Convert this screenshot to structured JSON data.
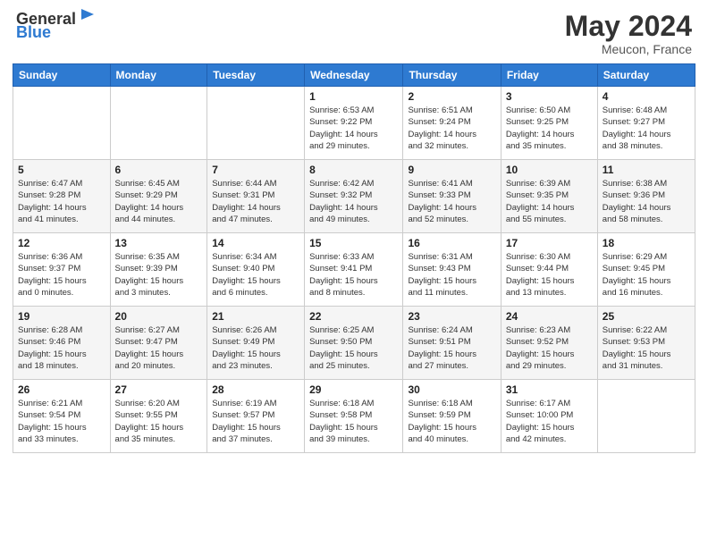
{
  "header": {
    "logo_text_general": "General",
    "logo_text_blue": "Blue",
    "title": "May 2024",
    "subtitle": "Meucon, France"
  },
  "days_of_week": [
    "Sunday",
    "Monday",
    "Tuesday",
    "Wednesday",
    "Thursday",
    "Friday",
    "Saturday"
  ],
  "weeks": [
    [
      {
        "day": "",
        "info": ""
      },
      {
        "day": "",
        "info": ""
      },
      {
        "day": "",
        "info": ""
      },
      {
        "day": "1",
        "info": "Sunrise: 6:53 AM\nSunset: 9:22 PM\nDaylight: 14 hours\nand 29 minutes."
      },
      {
        "day": "2",
        "info": "Sunrise: 6:51 AM\nSunset: 9:24 PM\nDaylight: 14 hours\nand 32 minutes."
      },
      {
        "day": "3",
        "info": "Sunrise: 6:50 AM\nSunset: 9:25 PM\nDaylight: 14 hours\nand 35 minutes."
      },
      {
        "day": "4",
        "info": "Sunrise: 6:48 AM\nSunset: 9:27 PM\nDaylight: 14 hours\nand 38 minutes."
      }
    ],
    [
      {
        "day": "5",
        "info": "Sunrise: 6:47 AM\nSunset: 9:28 PM\nDaylight: 14 hours\nand 41 minutes."
      },
      {
        "day": "6",
        "info": "Sunrise: 6:45 AM\nSunset: 9:29 PM\nDaylight: 14 hours\nand 44 minutes."
      },
      {
        "day": "7",
        "info": "Sunrise: 6:44 AM\nSunset: 9:31 PM\nDaylight: 14 hours\nand 47 minutes."
      },
      {
        "day": "8",
        "info": "Sunrise: 6:42 AM\nSunset: 9:32 PM\nDaylight: 14 hours\nand 49 minutes."
      },
      {
        "day": "9",
        "info": "Sunrise: 6:41 AM\nSunset: 9:33 PM\nDaylight: 14 hours\nand 52 minutes."
      },
      {
        "day": "10",
        "info": "Sunrise: 6:39 AM\nSunset: 9:35 PM\nDaylight: 14 hours\nand 55 minutes."
      },
      {
        "day": "11",
        "info": "Sunrise: 6:38 AM\nSunset: 9:36 PM\nDaylight: 14 hours\nand 58 minutes."
      }
    ],
    [
      {
        "day": "12",
        "info": "Sunrise: 6:36 AM\nSunset: 9:37 PM\nDaylight: 15 hours\nand 0 minutes."
      },
      {
        "day": "13",
        "info": "Sunrise: 6:35 AM\nSunset: 9:39 PM\nDaylight: 15 hours\nand 3 minutes."
      },
      {
        "day": "14",
        "info": "Sunrise: 6:34 AM\nSunset: 9:40 PM\nDaylight: 15 hours\nand 6 minutes."
      },
      {
        "day": "15",
        "info": "Sunrise: 6:33 AM\nSunset: 9:41 PM\nDaylight: 15 hours\nand 8 minutes."
      },
      {
        "day": "16",
        "info": "Sunrise: 6:31 AM\nSunset: 9:43 PM\nDaylight: 15 hours\nand 11 minutes."
      },
      {
        "day": "17",
        "info": "Sunrise: 6:30 AM\nSunset: 9:44 PM\nDaylight: 15 hours\nand 13 minutes."
      },
      {
        "day": "18",
        "info": "Sunrise: 6:29 AM\nSunset: 9:45 PM\nDaylight: 15 hours\nand 16 minutes."
      }
    ],
    [
      {
        "day": "19",
        "info": "Sunrise: 6:28 AM\nSunset: 9:46 PM\nDaylight: 15 hours\nand 18 minutes."
      },
      {
        "day": "20",
        "info": "Sunrise: 6:27 AM\nSunset: 9:47 PM\nDaylight: 15 hours\nand 20 minutes."
      },
      {
        "day": "21",
        "info": "Sunrise: 6:26 AM\nSunset: 9:49 PM\nDaylight: 15 hours\nand 23 minutes."
      },
      {
        "day": "22",
        "info": "Sunrise: 6:25 AM\nSunset: 9:50 PM\nDaylight: 15 hours\nand 25 minutes."
      },
      {
        "day": "23",
        "info": "Sunrise: 6:24 AM\nSunset: 9:51 PM\nDaylight: 15 hours\nand 27 minutes."
      },
      {
        "day": "24",
        "info": "Sunrise: 6:23 AM\nSunset: 9:52 PM\nDaylight: 15 hours\nand 29 minutes."
      },
      {
        "day": "25",
        "info": "Sunrise: 6:22 AM\nSunset: 9:53 PM\nDaylight: 15 hours\nand 31 minutes."
      }
    ],
    [
      {
        "day": "26",
        "info": "Sunrise: 6:21 AM\nSunset: 9:54 PM\nDaylight: 15 hours\nand 33 minutes."
      },
      {
        "day": "27",
        "info": "Sunrise: 6:20 AM\nSunset: 9:55 PM\nDaylight: 15 hours\nand 35 minutes."
      },
      {
        "day": "28",
        "info": "Sunrise: 6:19 AM\nSunset: 9:57 PM\nDaylight: 15 hours\nand 37 minutes."
      },
      {
        "day": "29",
        "info": "Sunrise: 6:18 AM\nSunset: 9:58 PM\nDaylight: 15 hours\nand 39 minutes."
      },
      {
        "day": "30",
        "info": "Sunrise: 6:18 AM\nSunset: 9:59 PM\nDaylight: 15 hours\nand 40 minutes."
      },
      {
        "day": "31",
        "info": "Sunrise: 6:17 AM\nSunset: 10:00 PM\nDaylight: 15 hours\nand 42 minutes."
      },
      {
        "day": "",
        "info": ""
      }
    ]
  ]
}
